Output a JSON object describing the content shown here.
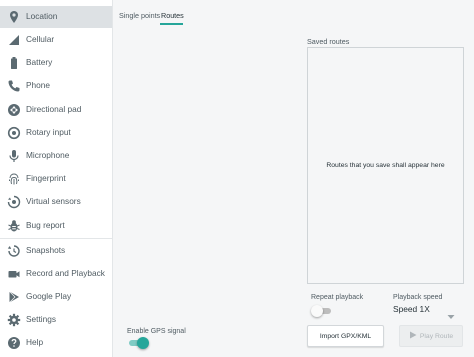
{
  "sidebar": {
    "items": [
      {
        "label": "Location",
        "icon": "location-pin-icon",
        "selected": true
      },
      {
        "label": "Cellular",
        "icon": "cellular-signal-icon"
      },
      {
        "label": "Battery",
        "icon": "battery-icon"
      },
      {
        "label": "Phone",
        "icon": "phone-icon"
      },
      {
        "label": "Directional pad",
        "icon": "dpad-icon"
      },
      {
        "label": "Rotary input",
        "icon": "rotary-dial-icon"
      },
      {
        "label": "Microphone",
        "icon": "microphone-icon"
      },
      {
        "label": "Fingerprint",
        "icon": "fingerprint-icon"
      },
      {
        "label": "Virtual sensors",
        "icon": "virtual-sensors-icon"
      },
      {
        "label": "Bug report",
        "icon": "bug-icon"
      },
      {
        "label": "Snapshots",
        "icon": "snapshots-icon"
      },
      {
        "label": "Record and Playback",
        "icon": "video-camera-icon"
      },
      {
        "label": "Google Play",
        "icon": "google-play-icon"
      },
      {
        "label": "Settings",
        "icon": "gear-icon"
      },
      {
        "label": "Help",
        "icon": "help-icon"
      }
    ]
  },
  "tabs": [
    {
      "label": "Single points",
      "active": false
    },
    {
      "label": "Routes",
      "active": true
    }
  ],
  "saved_routes": {
    "title": "Saved routes",
    "empty_message": "Routes that you save shall appear here"
  },
  "controls": {
    "gps_label": "Enable GPS signal",
    "gps_enabled": true,
    "repeat_label": "Repeat playback",
    "repeat_enabled": false,
    "speed_label": "Playback speed",
    "speed_value": "Speed 1X",
    "import_label": "Import GPX/KML",
    "play_label": "Play Route",
    "play_enabled": false
  },
  "colors": {
    "accent": "#26a69a",
    "icon": "#5b6a71",
    "selected_bg": "#dde1e4"
  }
}
